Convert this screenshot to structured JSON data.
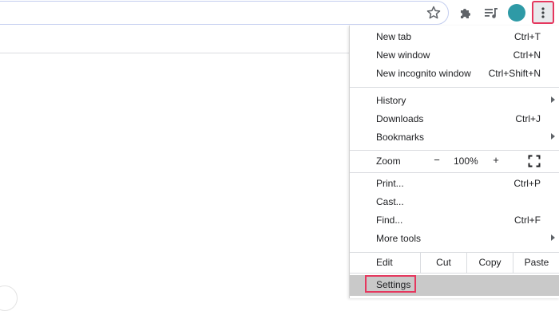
{
  "toolbar": {
    "icons": [
      "star-icon",
      "puzzle-icon",
      "media-control-icon",
      "avatar",
      "more-vert-icon"
    ],
    "avatar_color": "#2e9aa6",
    "highlight_color": "#e5375e"
  },
  "menu": {
    "group1": [
      {
        "label": "New tab",
        "shortcut": "Ctrl+T"
      },
      {
        "label": "New window",
        "shortcut": "Ctrl+N"
      },
      {
        "label": "New incognito window",
        "shortcut": "Ctrl+Shift+N"
      }
    ],
    "group2": [
      {
        "label": "History",
        "shortcut": ""
      },
      {
        "label": "Downloads",
        "shortcut": "Ctrl+J"
      },
      {
        "label": "Bookmarks",
        "shortcut": ""
      }
    ],
    "zoom": {
      "label": "Zoom",
      "minus": "−",
      "value": "100%",
      "plus": "+"
    },
    "group3": [
      {
        "label": "Print...",
        "shortcut": "Ctrl+P"
      },
      {
        "label": "Cast...",
        "shortcut": ""
      },
      {
        "label": "Find...",
        "shortcut": "Ctrl+F"
      },
      {
        "label": "More tools",
        "shortcut": ""
      }
    ],
    "edit": {
      "label": "Edit",
      "cut": "Cut",
      "copy": "Copy",
      "paste": "Paste"
    },
    "settings": {
      "label": "Settings"
    }
  }
}
